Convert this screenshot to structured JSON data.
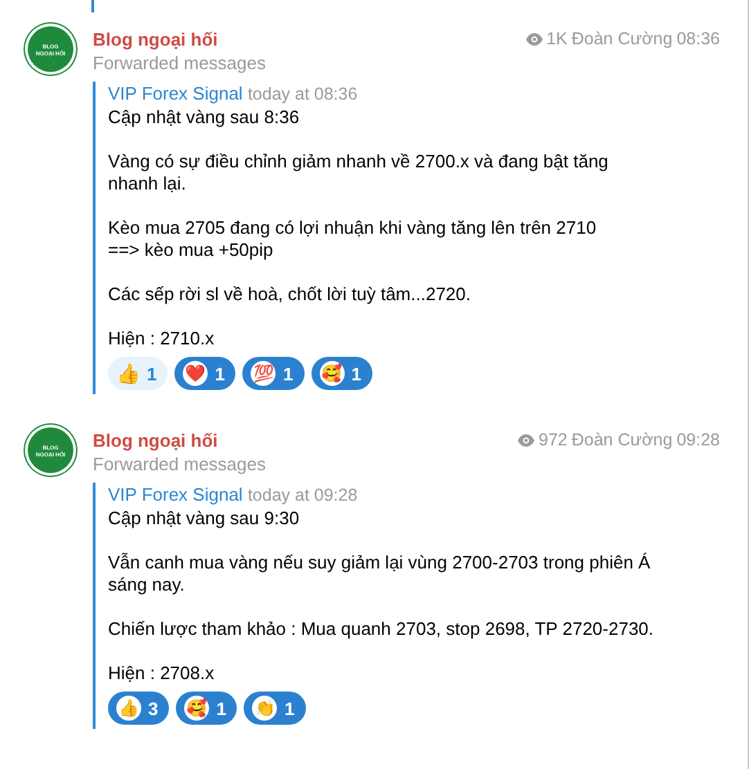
{
  "messages": [
    {
      "channel": "Blog ngoại hối",
      "avatar_text": [
        "BLOG",
        "NGOẠI HỐI"
      ],
      "subtitle": "Forwarded messages",
      "views": "1K",
      "author": "Đoàn Cường",
      "time": "08:36",
      "forward_from": "VIP Forex Signal",
      "forward_time": "today at 08:36",
      "paragraphs": [
        "Cập nhật vàng sau 8:36",
        "Vàng có sự điều chỉnh giảm nhanh về 2700.x và đang bật tăng nhanh lại.",
        "Kèo mua 2705 đang có lợi nhuận khi vàng tăng lên trên 2710\n==> kèo mua +50pip",
        "Các sếp rời sl về hoà, chốt lời tuỳ tâm...2720.",
        "Hiện : 2710.x"
      ],
      "reactions": [
        {
          "emoji": "👍",
          "count": "1",
          "selected": false
        },
        {
          "emoji": "❤️",
          "count": "1",
          "selected": true
        },
        {
          "emoji": "💯",
          "count": "1",
          "selected": true
        },
        {
          "emoji": "🥰",
          "count": "1",
          "selected": true
        }
      ]
    },
    {
      "channel": "Blog ngoại hối",
      "avatar_text": [
        "BLOG",
        "NGOẠI HỐI"
      ],
      "subtitle": "Forwarded messages",
      "views": "972",
      "author": "Đoàn Cường",
      "time": "09:28",
      "forward_from": "VIP Forex Signal",
      "forward_time": "today at 09:28",
      "paragraphs": [
        "Cập nhật vàng sau 9:30",
        "Vẫn canh mua vàng nếu suy giảm lại vùng 2700-2703 trong phiên Á sáng nay.",
        "Chiến lược tham khảo : Mua quanh 2703, stop 2698, TP 2720-2730.",
        "Hiện : 2708.x"
      ],
      "reactions": [
        {
          "emoji": "👍",
          "count": "3",
          "selected": true
        },
        {
          "emoji": "🥰",
          "count": "1",
          "selected": true
        },
        {
          "emoji": "👏",
          "count": "1",
          "selected": true
        }
      ]
    }
  ]
}
